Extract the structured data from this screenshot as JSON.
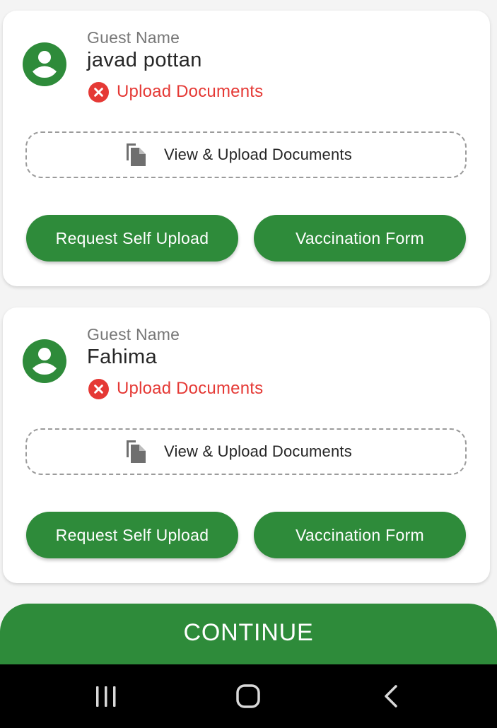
{
  "guests": [
    {
      "label": "Guest Name",
      "name": "javad pottan",
      "status": "Upload Documents",
      "upload_label": "View & Upload Documents",
      "request_label": "Request Self Upload",
      "vaccination_label": "Vaccination Form"
    },
    {
      "label": "Guest Name",
      "name": "Fahima",
      "status": "Upload Documents",
      "upload_label": "View & Upload Documents",
      "request_label": "Request Self Upload",
      "vaccination_label": "Vaccination Form"
    }
  ],
  "continue_label": "CONTINUE",
  "icons": {
    "avatar": "person-icon",
    "status": "error-x-icon",
    "document": "document-copy-icon",
    "nav_recent": "recent-apps-icon",
    "nav_home": "home-icon",
    "nav_back": "back-icon"
  },
  "colors": {
    "primary": "#2e8b3a",
    "error": "#e53935",
    "background": "#f4f4f4",
    "card": "#ffffff",
    "nav_bar": "#000000"
  }
}
